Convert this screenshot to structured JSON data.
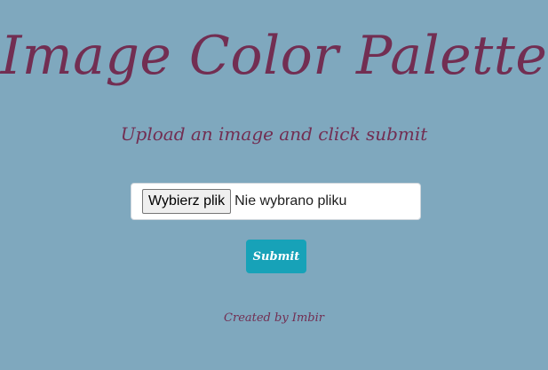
{
  "page": {
    "title": "Image Color Palette",
    "subtitle": "Upload an image and click submit"
  },
  "upload": {
    "choose_label": "Wybierz plik",
    "status_text": "Nie wybrano pliku"
  },
  "actions": {
    "submit_label": "Submit"
  },
  "footer": {
    "credit": "Created by Imbir"
  },
  "colors": {
    "background": "#7fa8be",
    "title_text": "#722e52",
    "submit_button": "#17a2b8"
  }
}
